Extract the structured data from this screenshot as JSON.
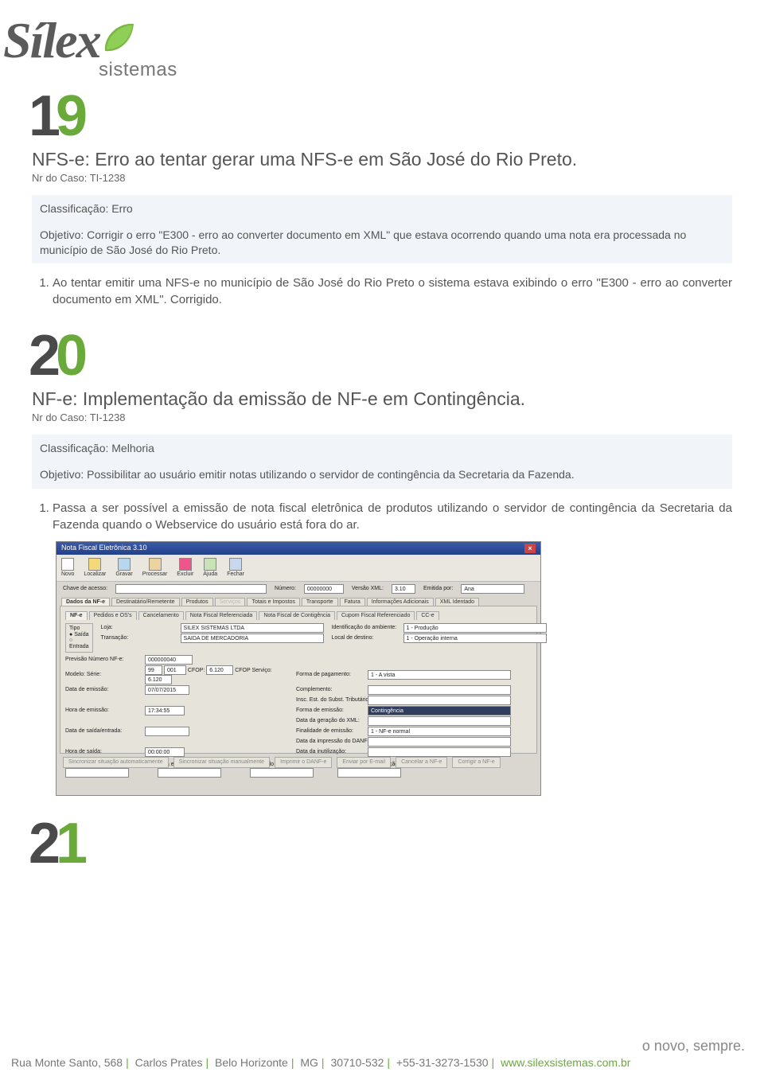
{
  "logo": {
    "brand": "Sílex",
    "subbrand": "sistemas"
  },
  "sections": [
    {
      "number_d1": "1",
      "number_d2": "9",
      "title": "NFS-e: Erro ao tentar gerar uma NFS-e em São José do Rio Preto.",
      "case_line": "Nr do Caso: TI-1238",
      "class_line": "Classificação: Erro",
      "objective": "Objetivo: Corrigir o erro \"E300 - erro ao converter documento em XML\" que estava ocorrendo quando uma nota era processada no município de São José do Rio Preto.",
      "item": "Ao tentar emitir uma NFS-e no município de São José do Rio Preto o sistema estava exibindo o erro \"E300 - erro ao converter documento em XML\". Corrigido."
    },
    {
      "number_d1": "2",
      "number_d2": "0",
      "title": "NF-e: Implementação da emissão de NF-e em Contingência.",
      "case_line": "Nr do Caso: TI-1238",
      "class_line": "Classificação: Melhoria",
      "objective": "Objetivo: Possibilitar ao usuário emitir notas utilizando o servidor de contingência da Secretaria da Fazenda.",
      "item": "Passa a ser possível a emissão de nota fiscal eletrônica de produtos utilizando o servidor de contingência da Secretaria da Fazenda quando o Webservice do usuário está fora do ar."
    },
    {
      "number_d1": "2",
      "number_d2": "1"
    }
  ],
  "app": {
    "title": "Nota Fiscal Eletrônica 3.10",
    "toolbar": [
      "Novo",
      "Localizar",
      "Gravar",
      "Processar",
      "Excluir",
      "Ajuda",
      "Fechar"
    ],
    "top_row": {
      "chave_label": "Chave de acesso:",
      "numero_label": "Número:",
      "numero": "00000000",
      "versao_label": "Versão XML:",
      "versao": "3.10",
      "emitida_label": "Emitida por:",
      "emitida": "Ana"
    },
    "tabs1": [
      "Dados da NF-e",
      "Destinatário/Remetente",
      "Produtos",
      "Serviços",
      "Totais e Impostos",
      "Transporte",
      "Fatura",
      "Informações Adicionais",
      "XML Identado"
    ],
    "tabs2": [
      "NF-e",
      "Pedidos e OS's",
      "Cancelamento",
      "Nota Fiscal Referenciada",
      "Nota Fiscal de Contigência",
      "Cupom Fiscal Referenciado",
      "CC-e"
    ],
    "form": {
      "tipo_label": "Tipo",
      "tipo_saida": "Saída",
      "tipo_entrada": "Entrada",
      "loja_label": "Loja:",
      "loja": "SILEX SISTEMAS LTDA",
      "ambiente_label": "Identificação do ambiente:",
      "ambiente": "1 - Produção",
      "prev_label": "Previsão Número NF-e:",
      "prev": "000000040",
      "trans_label": "Transação:",
      "trans": "SAIDA DE MERCADORIA",
      "dest_label": "Local de destino:",
      "dest": "1 - Operação interna",
      "modelo_label": "Modelo:",
      "modelo": "99",
      "serie_label": "Série:",
      "serie": "001",
      "cfop_label": "CFOP:",
      "cfop": "6.120",
      "cfopserv_label": "CFOP Serviço:",
      "cfopserv": "6.120",
      "pag_label": "Forma de pagamento:",
      "pag": "1 - A vista",
      "dataem_label": "Data de emissão:",
      "dataem": "07/07/2015",
      "complemento_label": "Complemento:",
      "insc_label": "Insc. Est. do Subst. Tributário:",
      "horaem_label": "Hora de emissão:",
      "horaem": "17:34:55",
      "formaem_label": "Forma de emissão:",
      "formaem": "Contingência",
      "dataxml_label": "Data da geração do XML:",
      "datasaida_label": "Data de saída/entrada:",
      "finalidade_label": "Finalidade de emissão:",
      "finalidade": "1 - NF-e normal",
      "datadanfe_label": "Data da impressão do DANF-e:",
      "horasaida_label": "Hora de saída:",
      "horasaida": "00:00:00",
      "datainut_label": "Data da inutilização:"
    },
    "bottom": {
      "recibo_label": "Número do recibo do envio:",
      "dataaut_label": "Data e hora da autorização:",
      "protaut_label": "Protocolo de autorização:",
      "protinut_label": "Protocolo de inutilização:"
    },
    "actions": [
      "Sincronizar situação automaticamente",
      "Sincronizar situação manualmente",
      "Imprimir o DANF-e",
      "Enviar por E-mail",
      "Cancelar a NF-e",
      "Corrigir a NF-e"
    ]
  },
  "footer": {
    "slogan": "o novo, sempre.",
    "addr_parts": [
      "Rua Monte Santo, 568",
      "Carlos Prates",
      "Belo Horizonte",
      "MG",
      "30710-532",
      "+55-31-3273-1530"
    ],
    "url": "www.silexsistemas.com.br"
  }
}
